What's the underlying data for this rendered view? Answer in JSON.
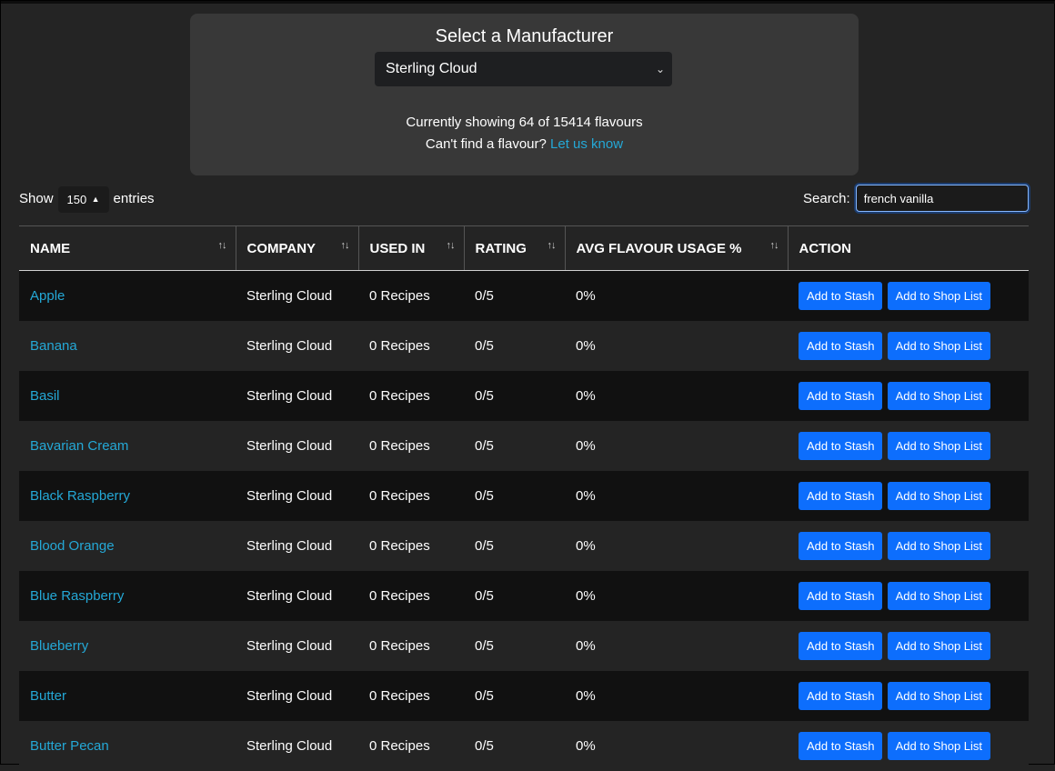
{
  "manufacturer": {
    "title": "Select a Manufacturer",
    "selected": "Sterling Cloud",
    "status_text": "Currently showing 64 of 15414 flavours",
    "missing_text": "Can't find a flavour?",
    "missing_link": "Let us know"
  },
  "controls": {
    "show_label": "Show",
    "entries_value": "150",
    "entries_label": "entries",
    "search_label": "Search:",
    "search_value": "french vanilla"
  },
  "table": {
    "headers": [
      "NAME",
      "COMPANY",
      "USED IN",
      "RATING",
      "AVG FLAVOUR USAGE %",
      "ACTION"
    ],
    "stash_label": "Add to Stash",
    "shop_label": "Add to Shop List",
    "rows": [
      {
        "name": "Apple",
        "company": "Sterling Cloud",
        "used_in": "0 Recipes",
        "rating": "0/5",
        "avg": "0%"
      },
      {
        "name": "Banana",
        "company": "Sterling Cloud",
        "used_in": "0 Recipes",
        "rating": "0/5",
        "avg": "0%"
      },
      {
        "name": "Basil",
        "company": "Sterling Cloud",
        "used_in": "0 Recipes",
        "rating": "0/5",
        "avg": "0%"
      },
      {
        "name": "Bavarian Cream",
        "company": "Sterling Cloud",
        "used_in": "0 Recipes",
        "rating": "0/5",
        "avg": "0%"
      },
      {
        "name": "Black Raspberry",
        "company": "Sterling Cloud",
        "used_in": "0 Recipes",
        "rating": "0/5",
        "avg": "0%"
      },
      {
        "name": "Blood Orange",
        "company": "Sterling Cloud",
        "used_in": "0 Recipes",
        "rating": "0/5",
        "avg": "0%"
      },
      {
        "name": "Blue Raspberry",
        "company": "Sterling Cloud",
        "used_in": "0 Recipes",
        "rating": "0/5",
        "avg": "0%"
      },
      {
        "name": "Blueberry",
        "company": "Sterling Cloud",
        "used_in": "0 Recipes",
        "rating": "0/5",
        "avg": "0%"
      },
      {
        "name": "Butter",
        "company": "Sterling Cloud",
        "used_in": "0 Recipes",
        "rating": "0/5",
        "avg": "0%"
      },
      {
        "name": "Butter Pecan",
        "company": "Sterling Cloud",
        "used_in": "0 Recipes",
        "rating": "0/5",
        "avg": "0%"
      }
    ]
  },
  "colors": {
    "accent_link": "#24a8d6",
    "button_primary": "#0d6efd",
    "panel": "#383838",
    "background": "#242424"
  }
}
